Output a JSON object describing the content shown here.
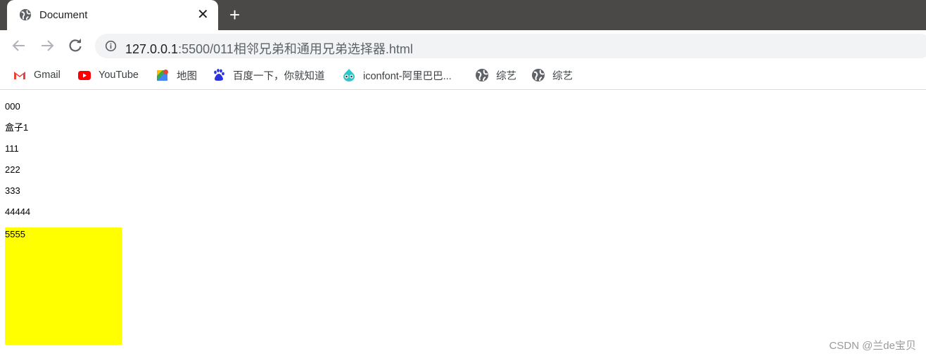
{
  "browser": {
    "tab": {
      "title": "Document",
      "icon": "globe-icon",
      "close_label": "✕"
    },
    "new_tab_label": "+",
    "address": {
      "host": "127.0.0.1",
      "rest": ":5500/011相邻兄弟和通用兄弟选择器.html"
    },
    "bookmarks": [
      {
        "label": "Gmail",
        "icon": "gmail-icon"
      },
      {
        "label": "YouTube",
        "icon": "youtube-icon"
      },
      {
        "label": "地图",
        "icon": "maps-icon"
      },
      {
        "label": "百度一下，你就知道",
        "icon": "baidu-icon"
      },
      {
        "label": "iconfont-阿里巴巴...",
        "icon": "iconfont-icon"
      },
      {
        "label": "综艺",
        "icon": "globe-icon"
      },
      {
        "label": "综艺",
        "icon": "globe-icon"
      }
    ]
  },
  "page": {
    "lines": [
      "000",
      "盒子1",
      "111",
      "222",
      "333",
      "44444"
    ],
    "highlighted_box": {
      "text": "5555",
      "color": "#ffff00"
    }
  },
  "watermark": "CSDN @兰de宝贝"
}
